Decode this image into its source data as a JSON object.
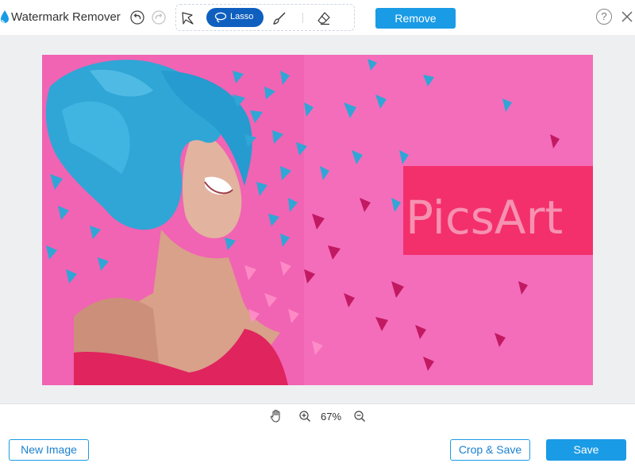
{
  "app": {
    "title": "Watermark Remover",
    "accent_color": "#1a9be6",
    "active_tool_color": "#0f5fbf"
  },
  "toolbar": {
    "undo_icon": "undo-icon",
    "redo_icon": "redo-icon",
    "tools": [
      {
        "icon": "polygon-lasso-icon",
        "active": false
      },
      {
        "icon": "lasso-icon",
        "label": "Lasso",
        "active": true
      },
      {
        "icon": "brush-icon",
        "active": false
      },
      {
        "icon": "eraser-icon",
        "active": false
      }
    ],
    "remove_label": "Remove",
    "help_label": "?",
    "close_icon": "close-icon"
  },
  "image": {
    "watermark_text": "PicsArt",
    "background_color": "#f05fb0",
    "hair_color": "#2fa6d6",
    "shirt_color": "#e0245e"
  },
  "zoom": {
    "hand_icon": "hand-icon",
    "zoom_in_icon": "zoom-in-icon",
    "level": "67%",
    "zoom_out_icon": "zoom-out-icon"
  },
  "footer": {
    "new_image_label": "New Image",
    "crop_save_label": "Crop & Save",
    "save_label": "Save"
  }
}
